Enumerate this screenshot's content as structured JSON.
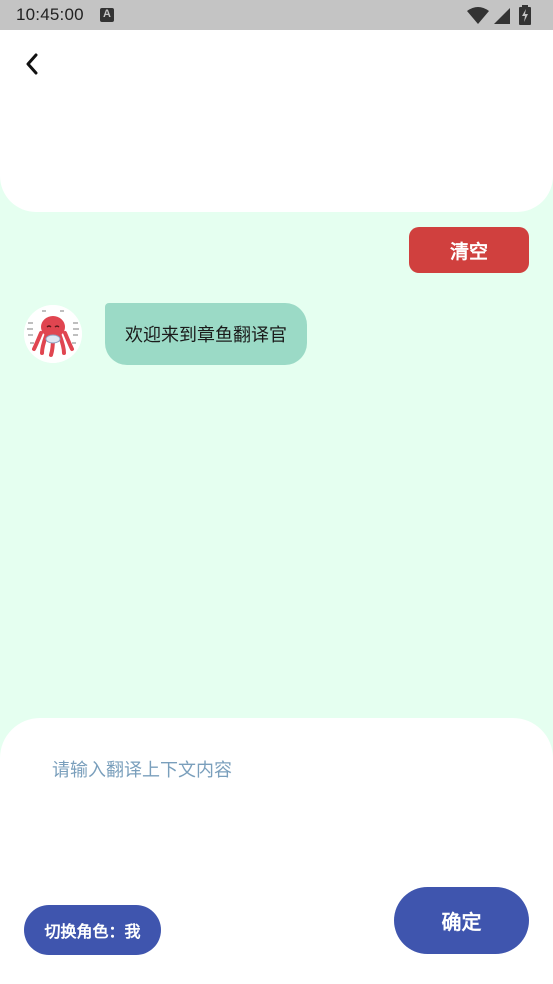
{
  "status_bar": {
    "time": "10:45:00",
    "notification_icon": "a-icon",
    "icons": [
      "wifi-icon",
      "cellular-signal-icon",
      "battery-charging-icon"
    ]
  },
  "header": {
    "back_icon": "chevron-left-icon"
  },
  "chat": {
    "clear_label": "清空",
    "messages": [
      {
        "sender": "translator",
        "avatar": "octopus-avatar",
        "text": "欢迎来到章鱼翻译官"
      }
    ]
  },
  "composer": {
    "placeholder": "请输入翻译上下文内容",
    "value": "",
    "role_label": "切换角色：我",
    "confirm_label": "确定"
  },
  "colors": {
    "background": "#e5fff0",
    "clear_button": "#d0403e",
    "bubble": "#9bdac6",
    "primary": "#3f55ae",
    "placeholder": "#7a9fbc"
  }
}
